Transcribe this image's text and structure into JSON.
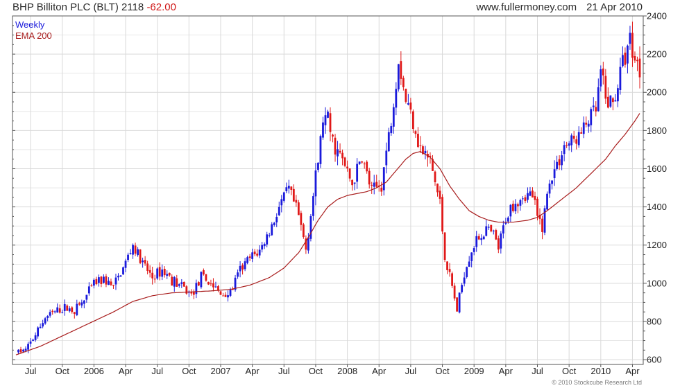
{
  "header": {
    "name": "BHP Billiton PLC (BLT)",
    "price": "2118",
    "change": "-62.00",
    "site": "www.fullermoney.com",
    "date": "21 Apr 2010"
  },
  "footer": {
    "copyright": "© 2010 Stockcube Research Ltd"
  },
  "colors": {
    "up": "#1a1adb",
    "down": "#e01818",
    "ema": "#a81c1c",
    "grid": "#d9d9d9",
    "frame": "#555555"
  },
  "chart_data": {
    "type": "candlestick",
    "title": "BHP Billiton PLC (BLT) 2118 -62.00",
    "xlabel": "",
    "ylabel": "",
    "ylim": [
      575,
      2400
    ],
    "y_ticks": [
      600,
      800,
      1000,
      1200,
      1400,
      1600,
      1800,
      2000,
      2200,
      2400
    ],
    "x_ticks": [
      {
        "label": "Jul",
        "week": 6
      },
      {
        "label": "Oct",
        "week": 19
      },
      {
        "label": "2006",
        "week": 32
      },
      {
        "label": "Apr",
        "week": 45
      },
      {
        "label": "Jul",
        "week": 58
      },
      {
        "label": "Oct",
        "week": 71
      },
      {
        "label": "2007",
        "week": 84
      },
      {
        "label": "Apr",
        "week": 97
      },
      {
        "label": "Jul",
        "week": 110
      },
      {
        "label": "Oct",
        "week": 123
      },
      {
        "label": "2008",
        "week": 136
      },
      {
        "label": "Apr",
        "week": 149
      },
      {
        "label": "Jul",
        "week": 162
      },
      {
        "label": "Oct",
        "week": 175
      },
      {
        "label": "2009",
        "week": 188
      },
      {
        "label": "Apr",
        "week": 201
      },
      {
        "label": "Jul",
        "week": 214
      },
      {
        "label": "Oct",
        "week": 227
      },
      {
        "label": "2010",
        "week": 240
      },
      {
        "label": "Apr",
        "week": 253
      }
    ],
    "legend": [
      "Weekly",
      "EMA 200"
    ],
    "legend_position": "top-left",
    "grid": true,
    "weeks": 256,
    "close_anchors": [
      [
        0,
        640
      ],
      [
        4,
        650
      ],
      [
        8,
        730
      ],
      [
        12,
        820
      ],
      [
        16,
        850
      ],
      [
        20,
        870
      ],
      [
        24,
        860
      ],
      [
        28,
        910
      ],
      [
        32,
        1000
      ],
      [
        36,
        1020
      ],
      [
        40,
        980
      ],
      [
        44,
        1080
      ],
      [
        48,
        1200
      ],
      [
        52,
        1100
      ],
      [
        56,
        1030
      ],
      [
        60,
        1070
      ],
      [
        64,
        1020
      ],
      [
        68,
        980
      ],
      [
        72,
        940
      ],
      [
        76,
        1030
      ],
      [
        80,
        1000
      ],
      [
        84,
        940
      ],
      [
        88,
        950
      ],
      [
        92,
        1070
      ],
      [
        96,
        1130
      ],
      [
        100,
        1170
      ],
      [
        104,
        1270
      ],
      [
        108,
        1400
      ],
      [
        112,
        1490
      ],
      [
        116,
        1350
      ],
      [
        119,
        1180
      ],
      [
        124,
        1640
      ],
      [
        126,
        1860
      ],
      [
        128,
        1850
      ],
      [
        130,
        1740
      ],
      [
        134,
        1640
      ],
      [
        138,
        1520
      ],
      [
        142,
        1660
      ],
      [
        146,
        1480
      ],
      [
        150,
        1520
      ],
      [
        154,
        1860
      ],
      [
        157,
        2180
      ],
      [
        160,
        1960
      ],
      [
        163,
        1860
      ],
      [
        166,
        1700
      ],
      [
        170,
        1640
      ],
      [
        174,
        1420
      ],
      [
        176,
        1140
      ],
      [
        179,
        980
      ],
      [
        181,
        860
      ],
      [
        184,
        1060
      ],
      [
        187,
        1180
      ],
      [
        190,
        1240
      ],
      [
        193,
        1280
      ],
      [
        196,
        1250
      ],
      [
        198,
        1180
      ],
      [
        201,
        1340
      ],
      [
        204,
        1420
      ],
      [
        208,
        1460
      ],
      [
        212,
        1460
      ],
      [
        214,
        1340
      ],
      [
        216,
        1300
      ],
      [
        219,
        1540
      ],
      [
        222,
        1620
      ],
      [
        225,
        1720
      ],
      [
        228,
        1740
      ],
      [
        232,
        1780
      ],
      [
        235,
        1860
      ],
      [
        238,
        1900
      ],
      [
        240,
        2100
      ],
      [
        242,
        1960
      ],
      [
        245,
        1940
      ],
      [
        248,
        2100
      ],
      [
        250,
        2200
      ],
      [
        252,
        2280
      ],
      [
        254,
        2180
      ],
      [
        256,
        2118
      ]
    ],
    "ema_anchors": [
      [
        0,
        625
      ],
      [
        10,
        670
      ],
      [
        20,
        730
      ],
      [
        30,
        790
      ],
      [
        40,
        850
      ],
      [
        48,
        905
      ],
      [
        56,
        935
      ],
      [
        64,
        950
      ],
      [
        72,
        955
      ],
      [
        80,
        960
      ],
      [
        88,
        968
      ],
      [
        96,
        990
      ],
      [
        104,
        1030
      ],
      [
        110,
        1080
      ],
      [
        116,
        1160
      ],
      [
        120,
        1240
      ],
      [
        124,
        1330
      ],
      [
        128,
        1400
      ],
      [
        132,
        1440
      ],
      [
        136,
        1460
      ],
      [
        140,
        1470
      ],
      [
        144,
        1480
      ],
      [
        148,
        1500
      ],
      [
        152,
        1530
      ],
      [
        156,
        1590
      ],
      [
        160,
        1650
      ],
      [
        163,
        1680
      ],
      [
        166,
        1690
      ],
      [
        170,
        1660
      ],
      [
        174,
        1600
      ],
      [
        178,
        1510
      ],
      [
        182,
        1440
      ],
      [
        186,
        1380
      ],
      [
        190,
        1350
      ],
      [
        194,
        1330
      ],
      [
        198,
        1320
      ],
      [
        204,
        1320
      ],
      [
        210,
        1330
      ],
      [
        214,
        1345
      ],
      [
        218,
        1380
      ],
      [
        222,
        1420
      ],
      [
        226,
        1460
      ],
      [
        230,
        1500
      ],
      [
        234,
        1550
      ],
      [
        238,
        1600
      ],
      [
        242,
        1650
      ],
      [
        246,
        1720
      ],
      [
        250,
        1780
      ],
      [
        254,
        1850
      ],
      [
        256,
        1890
      ]
    ]
  }
}
